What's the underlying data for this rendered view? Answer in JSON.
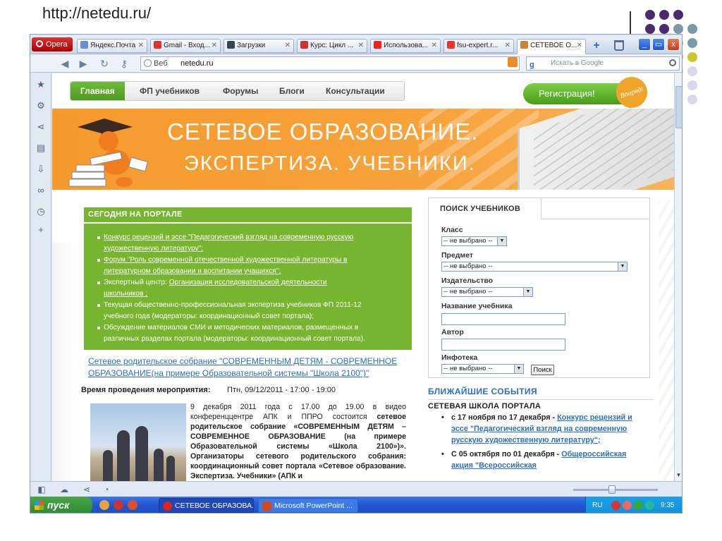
{
  "slide": {
    "url_caption": "http://netedu.ru/"
  },
  "browser": {
    "app_label": "Opera",
    "tabs": [
      {
        "label": "Яндекс.Почта"
      },
      {
        "label": "Gmail - Вход..."
      },
      {
        "label": "Загрузки"
      },
      {
        "label": "Курс: Цикл ..."
      },
      {
        "label": "Использова..."
      },
      {
        "label": "fsu-expert.r..."
      },
      {
        "label": "СЕТЕВОЕ О..."
      }
    ],
    "address": {
      "scheme_label": "Веб",
      "url": "netedu.ru"
    },
    "search": {
      "placeholder": "Искать в Google",
      "engine_letter": "g"
    },
    "window_buttons": {
      "minimize": "_",
      "restore": "▭",
      "close": "x"
    }
  },
  "site": {
    "menu": [
      "Главная",
      "ФП учебников",
      "Форумы",
      "Блоги",
      "Консультации"
    ],
    "register_button": "Регистрация!",
    "register_badge": "Вперед!",
    "banner": {
      "title": "СЕТЕВОЕ ОБРАЗОВАНИЕ.",
      "subtitle": "ЭКСПЕРТИЗА. УЧЕБНИКИ."
    },
    "today": {
      "heading": "СЕГОДНЯ НА ПОРТАЛЕ",
      "items": [
        {
          "lines": [
            "Конкурс рецензий и эссе \"Педагогический взгляд на современную русскую",
            "художественную литературу\";"
          ]
        },
        {
          "lines": [
            "Форум \"Роль современной отечественной художественной литературы в",
            "литературном образовании и воспитании учащихся\";"
          ]
        },
        {
          "prefix": "Экспертный центр: ",
          "lines": [
            "Организация исследовательской деятельности",
            "школьников ;"
          ]
        },
        {
          "lines": [
            "Текущая общественно-профессиональная экспертиза учебников ФП 2011-12",
            "учебного года (модераторы: координационный совет портала);"
          ]
        },
        {
          "lines": [
            "Обсуждение материалов СМИ и методических материалов, размещенных в",
            "различных разделах портала (модераторы: координационный совет портала)."
          ]
        }
      ]
    },
    "event": {
      "link_line1": "Сетевое родительское собрание \"СОВРЕМЕННЫМ ДЕТЯМ - СОВРЕМЕННОЕ",
      "link_line2": "ОБРАЗОВАНИЕ(на примере Образовательной системы \"Школа 2100\")\"",
      "time_label": "Время проведения мероприятия:",
      "time_value": "Птн, 09/12/2011 - 17:00 - 19:00",
      "text_plain1": "9 декабря 2011 года с 17.00 до 19.00 в видео конференццентре АПК и ППРО состоится ",
      "text_bold1": "сетевое родительское собрание «СОВРЕМЕННЫМ ДЕТЯМ – СОВРЕМЕННОЕ ОБРАЗОВАНИЕ (на примере Образовательной системы «Школа 2100»)». Организаторы сетевого родительского собрания: координационный совет портала «Сетевое образование. Экспертиза. Учебники» (АПК и"
    },
    "search_panel": {
      "tab": "ПОИСК УЧЕБНИКОВ",
      "class_label": "Класс",
      "class_value": "-- не выбрано --",
      "subject_label": "Предмет",
      "subject_value": "-- не выбрано --",
      "publisher_label": "Издательство",
      "publisher_value": "-- не выбрано --",
      "name_label": "Название учебника",
      "author_label": "Автор",
      "infotheque_label": "Инфотека",
      "infotheque_value": "-- не выбрано --",
      "submit": "Поиск"
    },
    "upcoming": {
      "title": "БЛИЖАЙШИЕ СОБЫТИЯ",
      "section": "СЕТЕВАЯ ШКОЛА ПОРТАЛА",
      "items": [
        {
          "date": "с 17 ноября по 17 декабря - ",
          "link": "Конкурс рецензий и эссе \"Педагогический взгляд на современную русскую художественную литературу\";"
        },
        {
          "date": "С 05 октября по 01 декабря - ",
          "link": "Общероссийская акция \"Всероссийская"
        }
      ]
    }
  },
  "taskbar": {
    "start": "пуск",
    "tasks": [
      {
        "label": "СЕТЕВОЕ ОБРАЗОВА..."
      },
      {
        "label": "Microsoft PowerPoint ..."
      }
    ],
    "lang": "RU",
    "clock": "9:35"
  },
  "colors": {
    "accent_green": "#76b52f",
    "banner_orange": "#f69a2d",
    "link_blue": "#2c6fc9"
  }
}
